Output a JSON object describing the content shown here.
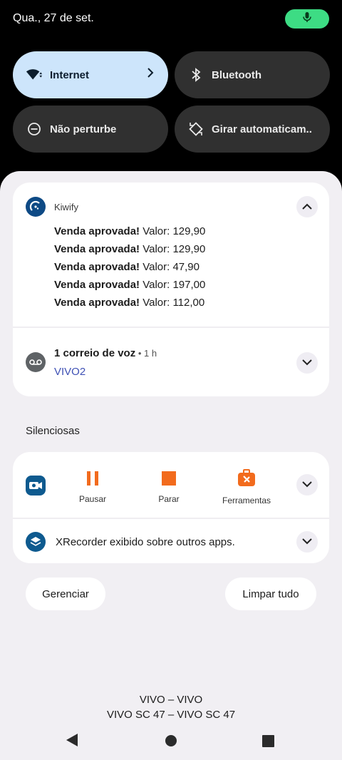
{
  "status_bar": {
    "date": "Qua., 27 de set."
  },
  "quick_tiles": [
    {
      "label": "Internet",
      "state": "on",
      "icon": "wifi-icon"
    },
    {
      "label": "Bluetooth",
      "state": "off",
      "icon": "bluetooth-icon"
    },
    {
      "label": "Não perturbe",
      "state": "off",
      "icon": "do-not-disturb-icon"
    },
    {
      "label": "Girar automaticam..",
      "state": "off",
      "icon": "auto-rotate-icon"
    }
  ],
  "notifications": {
    "kiwify": {
      "app_name": "Kiwify",
      "messages": [
        {
          "title": "Venda aprovada!",
          "body": "Valor: 129,90"
        },
        {
          "title": "Venda aprovada!",
          "body": "Valor: 129,90"
        },
        {
          "title": "Venda aprovada!",
          "body": "Valor: 47,90"
        },
        {
          "title": "Venda aprovada!",
          "body": "Valor: 197,00"
        },
        {
          "title": "Venda aprovada!",
          "body": "Valor: 112,00"
        }
      ]
    },
    "voicemail": {
      "title": "1 correio de voz",
      "time": " • 1 h",
      "subtitle": "VIVO2"
    }
  },
  "silent_section": {
    "label": "Silenciosas",
    "recorder": {
      "actions": [
        {
          "label": "Pausar",
          "icon": "pause-icon"
        },
        {
          "label": "Parar",
          "icon": "stop-icon"
        },
        {
          "label": "Ferramentas",
          "icon": "toolbox-icon"
        }
      ]
    },
    "overlay": {
      "text": "XRecorder exibido sobre outros apps."
    }
  },
  "buttons": {
    "manage": "Gerenciar",
    "clear_all": "Limpar tudo"
  },
  "carrier": {
    "line1": "VIVO – VIVO",
    "line2": "VIVO SC 47 – VIVO SC 47"
  },
  "colors": {
    "accent": "#cde5fb",
    "mic": "#3ddc84",
    "recorder_orange": "#f26b1d",
    "link": "#3f51b5"
  }
}
